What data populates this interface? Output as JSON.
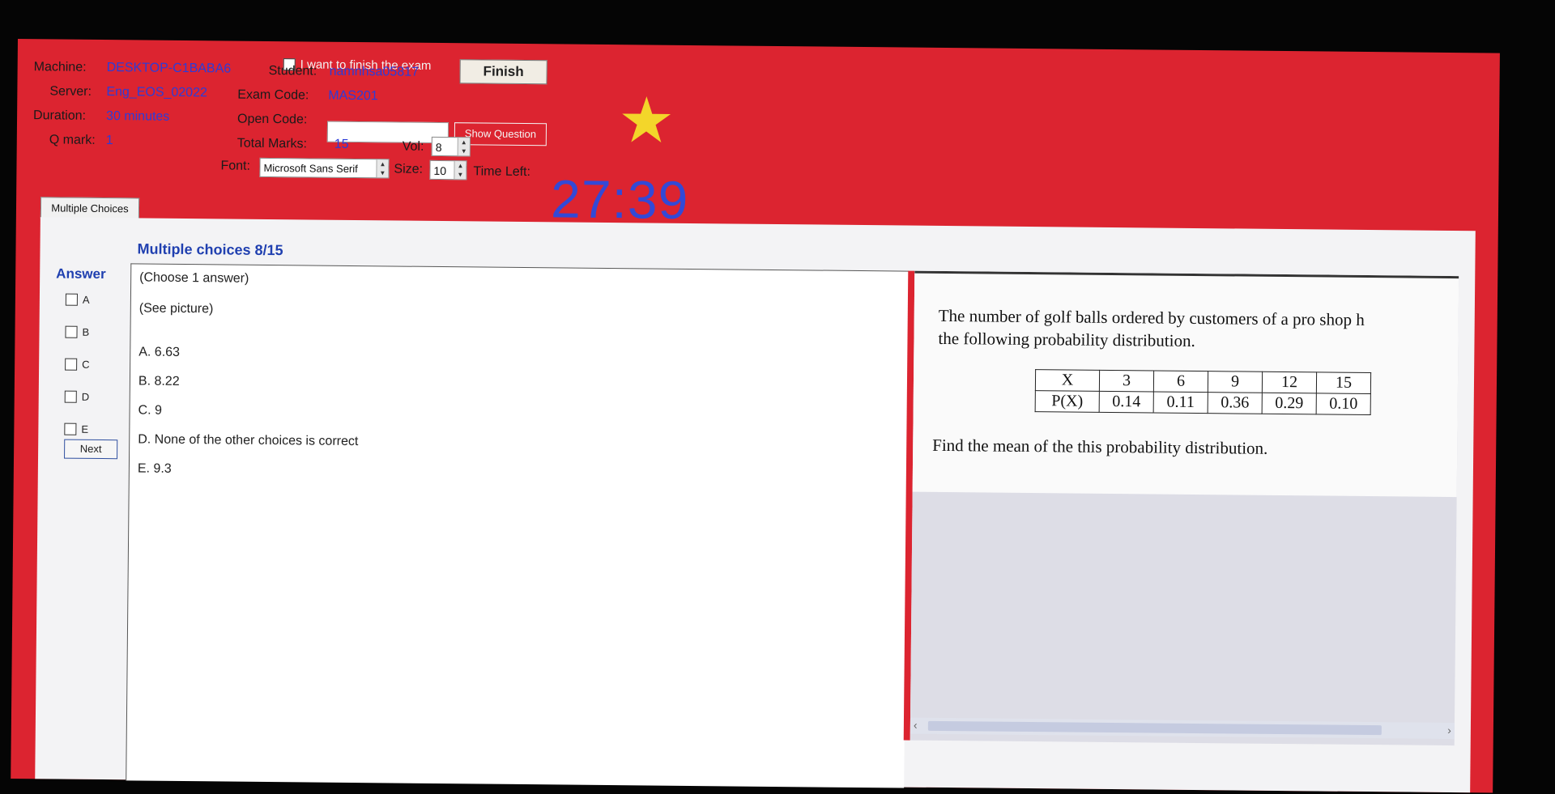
{
  "header": {
    "finish_check_label": "I want to finish the exam",
    "finish_button": "Finish",
    "machine_label": "Machine:",
    "machine_value": "DESKTOP-C1BABA6",
    "student_label": "Student:",
    "student_value": "namnhsa05817",
    "server_label": "Server:",
    "server_value": "Eng_EOS_02022",
    "exam_code_label": "Exam Code:",
    "exam_code_value": "MAS201",
    "duration_label": "Duration:",
    "duration_value": "30 minutes",
    "open_code_label": "Open Code:",
    "open_code_value": "",
    "show_question_button": "Show Question",
    "qmark_label": "Q mark:",
    "qmark_value": "1",
    "total_marks_label": "Total Marks:",
    "total_marks_value": "15",
    "vol_label": "Vol:",
    "vol_value": "8",
    "font_label": "Font:",
    "font_value": "Microsoft Sans Serif",
    "size_label": "Size:",
    "size_value": "10",
    "time_left_label": "Time Left:",
    "time_left_value": "27:39",
    "star_icon_color": "#f3d62a"
  },
  "tab": {
    "label": "Multiple Choices"
  },
  "main": {
    "title": "Multiple choices 8/15",
    "answer_label": "Answer",
    "options": [
      "A",
      "B",
      "C",
      "D",
      "E"
    ],
    "next_button": "Next",
    "answer_lines": [
      "(Choose 1 answer)",
      "(See picture)",
      "A. 6.63",
      "B. 8.22",
      "C. 9",
      "D. None of the other choices is correct",
      "E. 9.3"
    ]
  },
  "question": {
    "line1": "The number of golf balls ordered by customers of a pro shop h",
    "line2": "the following probability distribution.",
    "table_row_x": [
      "X",
      "3",
      "6",
      "9",
      "12",
      "15"
    ],
    "table_row_p": [
      "P(X)",
      "0.14",
      "0.11",
      "0.36",
      "0.29",
      "0.10"
    ],
    "line3": "Find the mean of the this probability distribution."
  },
  "colors": {
    "window_bg": "#dc2430",
    "accent_blue": "#2c3cd8",
    "timer": "#3349d6"
  }
}
